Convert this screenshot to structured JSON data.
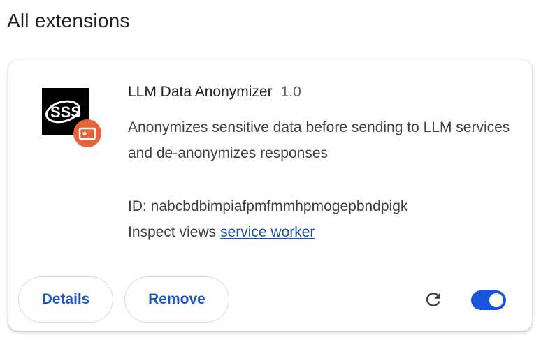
{
  "section": {
    "title": "All extensions"
  },
  "extension": {
    "name": "LLM Data Anonymizer",
    "version": "1.0",
    "description": "Anonymizes sensitive data before sending to LLM services and de-anonymizes responses",
    "id_text": "ID: nabcbdbimpiafpmfmmhpmogepbndpigk",
    "inspect_label": "Inspect views",
    "inspect_link": "service worker",
    "icon": "extension-logo-icon",
    "logo_text": "SSS",
    "badge_icon": "unpacked-badge-icon",
    "enabled": true
  },
  "actions": {
    "details_label": "Details",
    "remove_label": "Remove",
    "reload_icon": "reload-icon",
    "toggle_icon": "enable-toggle"
  },
  "colors": {
    "accent": "#1a56db",
    "badge": "#e8623a",
    "link": "#1a4fba"
  }
}
